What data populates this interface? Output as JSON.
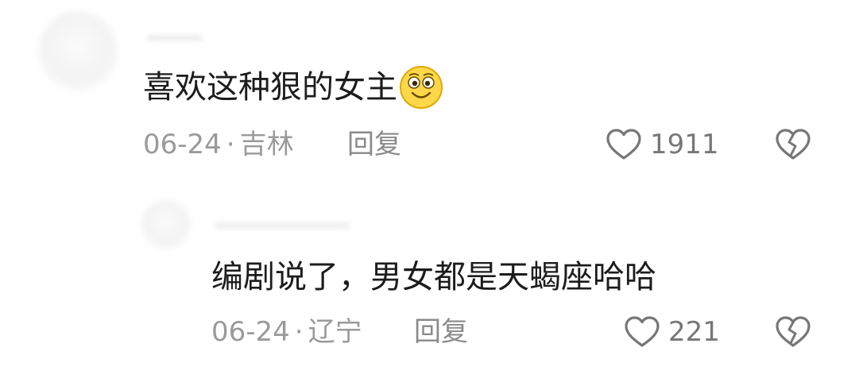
{
  "comments": [
    {
      "text": "喜欢这种狠的女主",
      "emoji": "smile-emoji",
      "date": "06-24",
      "separator": "·",
      "location": "吉林",
      "reply_label": "回复",
      "likes": "1911"
    },
    {
      "text": "编剧说了，男女都是天蝎座哈哈",
      "date": "06-24",
      "separator": "·",
      "location": "辽宁",
      "reply_label": "回复",
      "likes": "221"
    }
  ],
  "colors": {
    "text": "#1c1c1c",
    "meta": "#9a9a9a",
    "icon": "#777777",
    "emoji_face": "#ffd84a"
  },
  "icons": {
    "like": "heart-outline-icon",
    "dislike": "broken-heart-icon"
  }
}
